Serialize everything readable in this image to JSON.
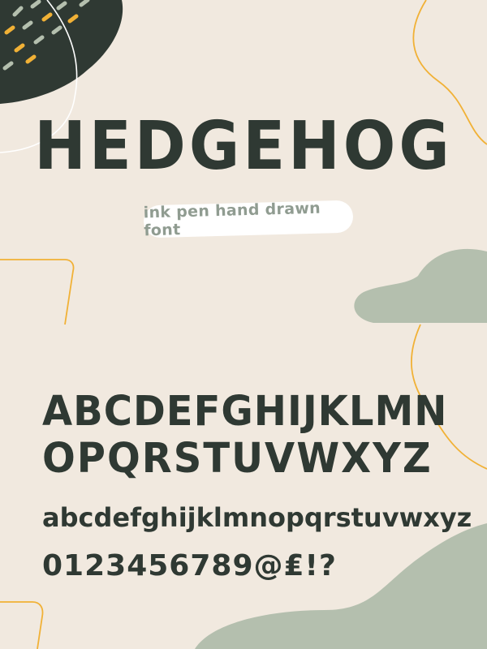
{
  "title": "HEDGEHOG",
  "subtitle": "ink pen hand drawn font",
  "specimen": {
    "uppercase_line1": "ABCDEFGHIJKLMN",
    "uppercase_line2": "OPQRSTUVWXYZ",
    "lowercase": "abcdefghijklmnopqrstuvwxyz",
    "digits_symbols": "0123456789@₤!?"
  },
  "colors": {
    "background": "#f1e9df",
    "ink": "#2f3933",
    "sage": "#b4bfae",
    "orange": "#f1b136",
    "subtitle_text": "#909c91"
  }
}
